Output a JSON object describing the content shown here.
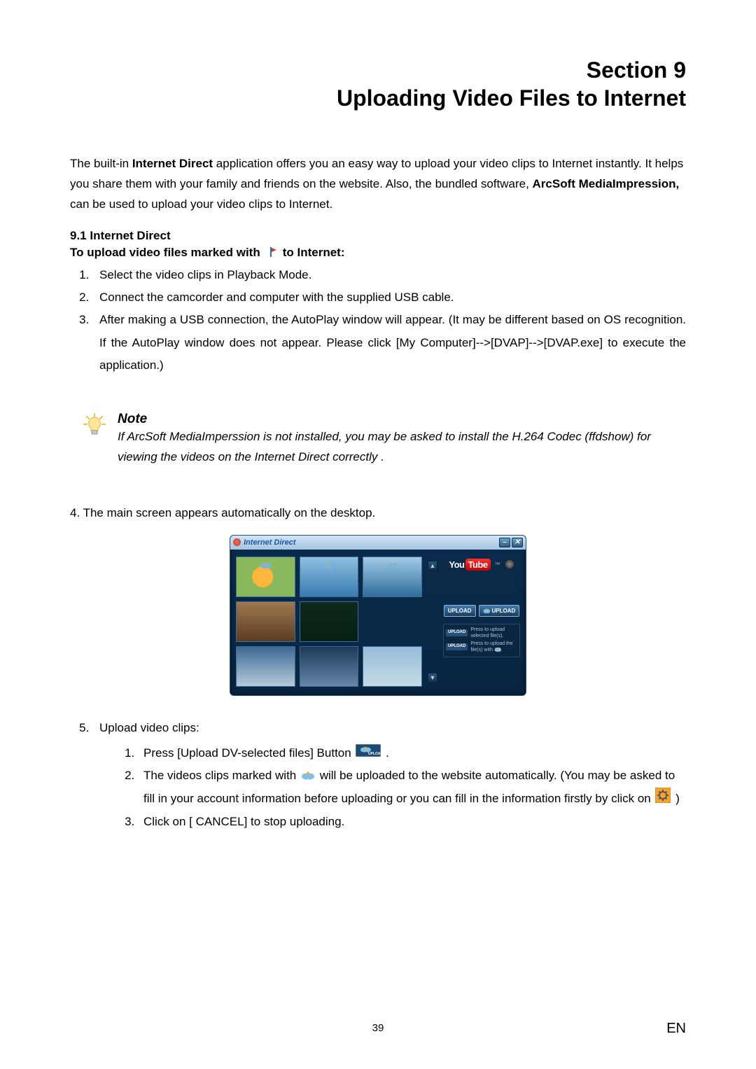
{
  "header": {
    "section_label": "Section 9",
    "title": "Uploading Video Files to Internet"
  },
  "intro": {
    "part1": "The built-in ",
    "bold1": "Internet Direct",
    "part2": " application offers you an easy way to upload your video clips to Internet instantly. It helps you share them with your family and friends on the website. Also, the bundled software, ",
    "bold2": "ArcSoft MediaImpression,",
    "part3": " can be used to upload your video clips to Internet."
  },
  "sub": {
    "num_title": "9.1 Internet Direct",
    "line2_a": "To upload video files marked with",
    "line2_b": "to Internet:"
  },
  "steps": {
    "s1": "Select the video clips in Playback Mode.",
    "s2": "Connect the camcorder and computer with the supplied USB cable.",
    "s3": "After making a USB connection, the AutoPlay window will appear. (It may be different based on OS recognition. If the AutoPlay window does not appear. Please click [My Computer]-->[DVAP]-->[DVAP.exe] to execute the application.)",
    "s4": "4. The main screen appears automatically on the desktop.",
    "s5": "Upload video clips:",
    "inner1_a": "Press [Upload DV-selected files] Button ",
    "inner1_b": " .",
    "inner2_a": "The videos clips marked with ",
    "inner2_b": " will be uploaded to the website automatically. (You may be asked to fill in your account information before uploading or you can fill in the information firstly by click on ",
    "inner2_c": " )",
    "inner3": "Click on [ CANCEL] to stop uploading."
  },
  "note": {
    "title": "Note",
    "body": "If ArcSoft MediaImperssion is not installed, you may be asked to install the H.264 Codec (ffdshow) for viewing the videos on the Internet Direct correctly ."
  },
  "app": {
    "title": "Internet Direct",
    "youtube_a": "You",
    "youtube_b": "Tube",
    "upload_btn": "UPLOAD",
    "upload_btn2": "UPLOAD",
    "hint1": "Press to upload selected file(s).",
    "hint2": "Press to upload the file(s) with"
  },
  "footer": {
    "page": "39",
    "lang": "EN"
  }
}
